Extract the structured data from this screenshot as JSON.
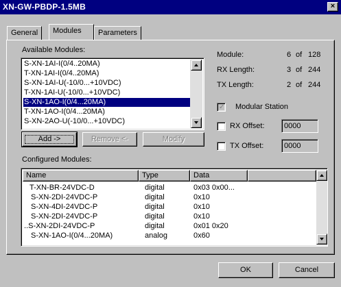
{
  "window": {
    "title": "XN-GW-PBDP-1.5MB",
    "close_glyph": "×"
  },
  "tabs": [
    {
      "label": "General",
      "active": false
    },
    {
      "label": "Modules",
      "active": true
    },
    {
      "label": "Parameters",
      "active": false
    }
  ],
  "available": {
    "label": "Available Modules:",
    "items": [
      "S-XN-1AI-I(0/4..20MA)",
      "T-XN-1AI-I(0/4..20MA)",
      "S-XN-1AI-U(-10/0...+10VDC)",
      "T-XN-1AI-U(-10/0...+10VDC)",
      "S-XN-1AO-I(0/4...20MA)",
      "T-XN-1AO-I(0/4...20MA)",
      "S-XN-2AO-U(-10/0...+10VDC)"
    ],
    "selected_index": 4
  },
  "buttons": {
    "add": "Add ->",
    "remove": "Remove <-",
    "modify": "Modify",
    "ok": "OK",
    "cancel": "Cancel"
  },
  "info": {
    "module_label": "Module:",
    "module_value": "6",
    "module_of": "of",
    "module_max": "128",
    "rx_label": "RX Length:",
    "rx_value": "3",
    "rx_of": "of",
    "rx_max": "244",
    "tx_label": "TX Length:",
    "tx_value": "2",
    "tx_of": "of",
    "tx_max": "244"
  },
  "options": {
    "modular_station_label": "Modular Station",
    "modular_station_checked": true,
    "rx_offset_label": "RX Offset:",
    "rx_offset_value": "0000",
    "tx_offset_label": "TX Offset:",
    "tx_offset_value": "0000"
  },
  "configured": {
    "label": "Configured Modules:",
    "columns": [
      "Name",
      "Type",
      "Data"
    ],
    "rows": [
      {
        "name": "T-XN-BR-24VDC-D",
        "type": "digital",
        "data": "0x03 0x00..."
      },
      {
        "name": "S-XN-2DI-24VDC-P",
        "type": "digital",
        "data": "0x10"
      },
      {
        "name": "S-XN-4DI-24VDC-P",
        "type": "digital",
        "data": "0x10"
      },
      {
        "name": "S-XN-2DI-24VDC-P",
        "type": "digital",
        "data": "0x10"
      },
      {
        "name": "..S-XN-2DI-24VDC-P",
        "type": "digital",
        "data": "0x01 0x20"
      },
      {
        "name": "S-XN-1AO-I(0/4...20MA)",
        "type": "analog",
        "data": "0x60"
      }
    ]
  },
  "colors": {
    "face": "#c0c0c0",
    "title_bar": "#000080",
    "selection": "#000080"
  }
}
